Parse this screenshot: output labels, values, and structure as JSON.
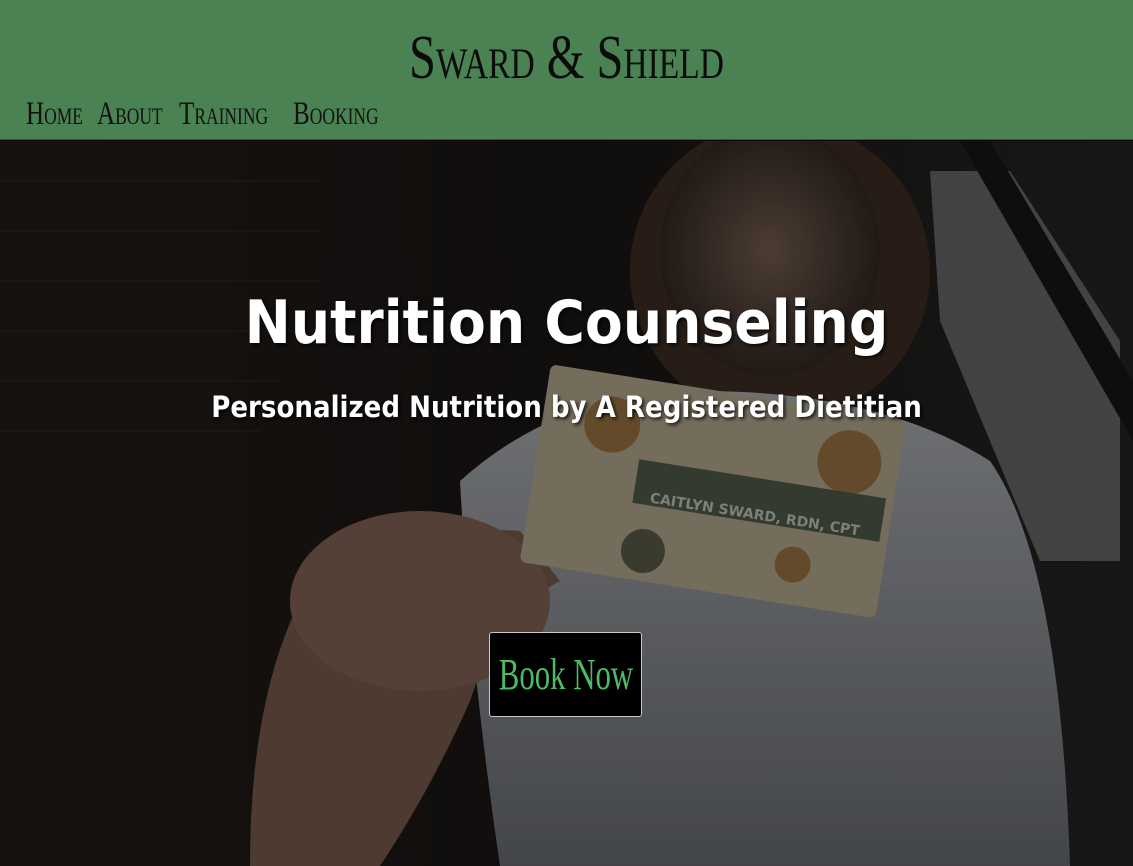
{
  "header": {
    "site_title": "Sward & Shield",
    "nav": {
      "home": "Home",
      "about": "About",
      "training": "Training",
      "booking": "Booking"
    }
  },
  "hero": {
    "heading": "Nutrition Counseling",
    "subheading": "Personalized Nutrition by A Registered Dietitian",
    "business_card_text": "CAITLYN SWARD, RDN, CPT",
    "cta_label": "Book Now"
  },
  "colors": {
    "header_bg": "#4a8253",
    "cta_text": "#4dbb63",
    "cta_bg": "#000000",
    "title_text": "#0c0c0c",
    "hero_text": "#ffffff"
  }
}
